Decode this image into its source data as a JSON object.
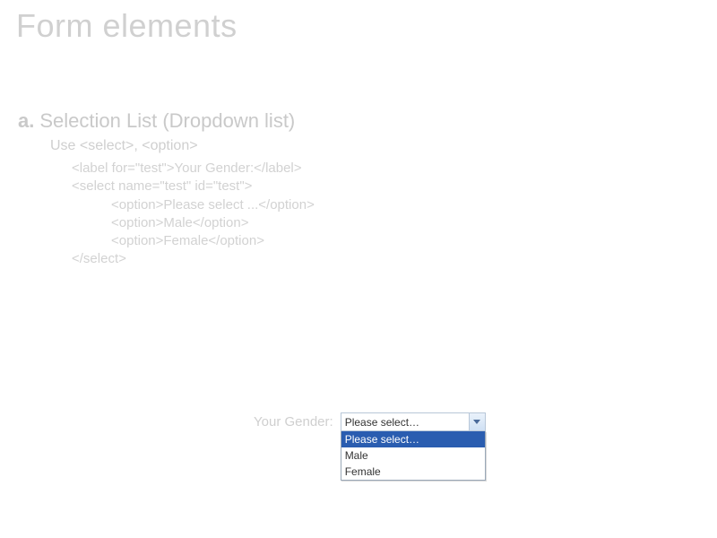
{
  "title": "Form elements",
  "section": {
    "bullet": "a.",
    "heading": "Selection List (Dropdown list)",
    "use": "Use <select>, <option>",
    "code": {
      "l1": "<label for=\"test\">Your Gender:</label>",
      "l2": "<select name=\"test\" id=\"test\">",
      "l3": "<option>Please select ...</option>",
      "l4": "<option>Male</option>",
      "l5": "<option>Female</option>",
      "l6": "</select>"
    }
  },
  "example": {
    "label": "Your Gender:",
    "selected": "Please select…",
    "options": {
      "o1": "Please select…",
      "o2": "Male",
      "o3": "Female"
    }
  }
}
